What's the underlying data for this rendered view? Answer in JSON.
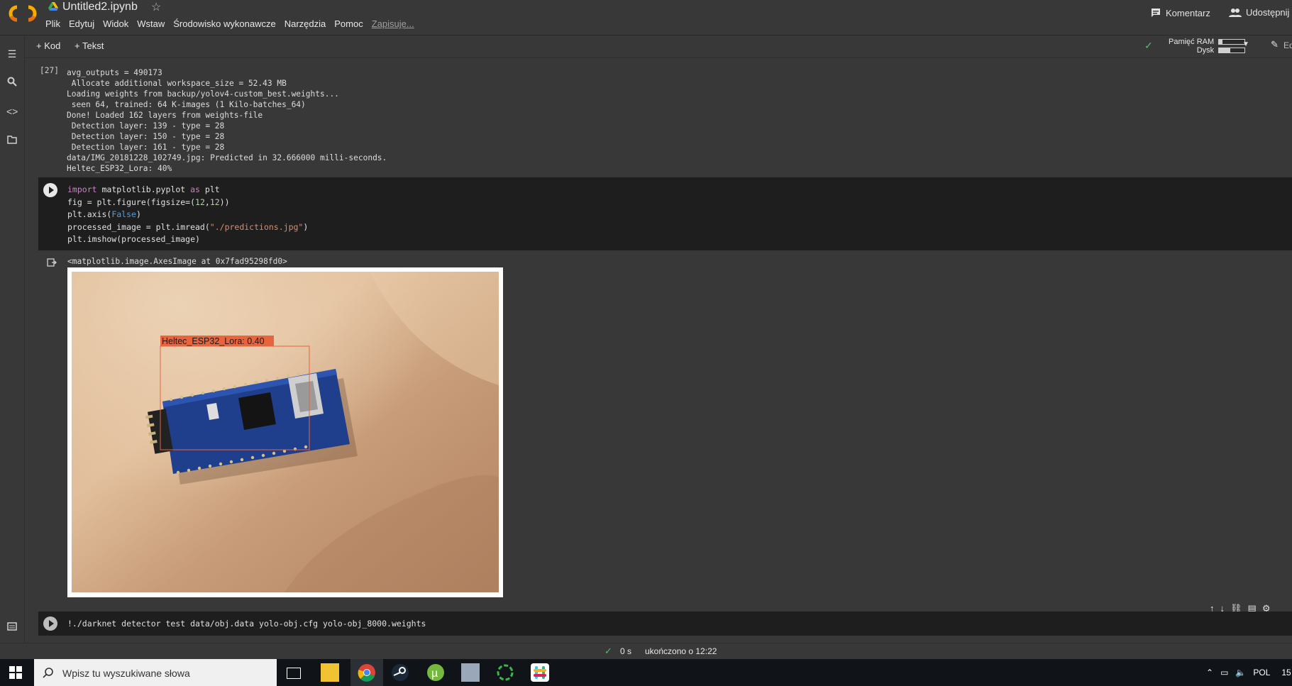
{
  "header": {
    "title": "Untitled2.ipynb",
    "menu": [
      "Plik",
      "Edytuj",
      "Widok",
      "Wstaw",
      "Środowisko wykonawcze",
      "Narzędzia",
      "Pomoc"
    ],
    "saving": "Zapisuję...",
    "comment_label": "Komentarz",
    "share_label": "Udostępnij"
  },
  "toolbar": {
    "add_code": "+ Kod",
    "add_text": "+ Tekst",
    "ram_label": "Pamięć RAM",
    "disk_label": "Dysk",
    "ram_fraction": 0.12,
    "disk_fraction": 0.45,
    "edit_label": "Ed"
  },
  "output1": {
    "exec_count": "[27]",
    "lines": [
      "avg_outputs = 490173",
      " Allocate additional workspace_size = 52.43 MB",
      "Loading weights from backup/yolov4-custom_best.weights...",
      " seen 64, trained: 64 K-images (1 Kilo-batches_64)",
      "Done! Loaded 162 layers from weights-file",
      " Detection layer: 139 - type = 28",
      " Detection layer: 150 - type = 28",
      " Detection layer: 161 - type = 28",
      "data/IMG_20181228_102749.jpg: Predicted in 32.666000 milli-seconds.",
      "Heltec_ESP32_Lora: 40%"
    ]
  },
  "code_cell": {
    "lines": [
      "import matplotlib.pyplot as plt",
      "fig = plt.figure(figsize=(12,12))",
      "plt.axis(False)",
      "processed_image = plt.imread(\"./predictions.jpg\")",
      "plt.imshow(processed_image)"
    ]
  },
  "output2": {
    "repr": "<matplotlib.image.AxesImage at 0x7fad95298fd0>",
    "detection_label": "Heltec_ESP32_Lora: 0.40"
  },
  "code_cell2": {
    "line": "!./darknet detector test data/obj.data yolo-obj.cfg yolo-obj_8000.weights"
  },
  "status": {
    "time": "0 s",
    "done": "ukończono o 12:22"
  },
  "taskbar": {
    "search_placeholder": "Wpisz tu wyszukiwane słowa",
    "lang": "POL",
    "clock": "15"
  },
  "colors": {
    "accent_orange": "#f9ab00",
    "detection_box": "#e8643c",
    "check_green": "#5bb974"
  }
}
